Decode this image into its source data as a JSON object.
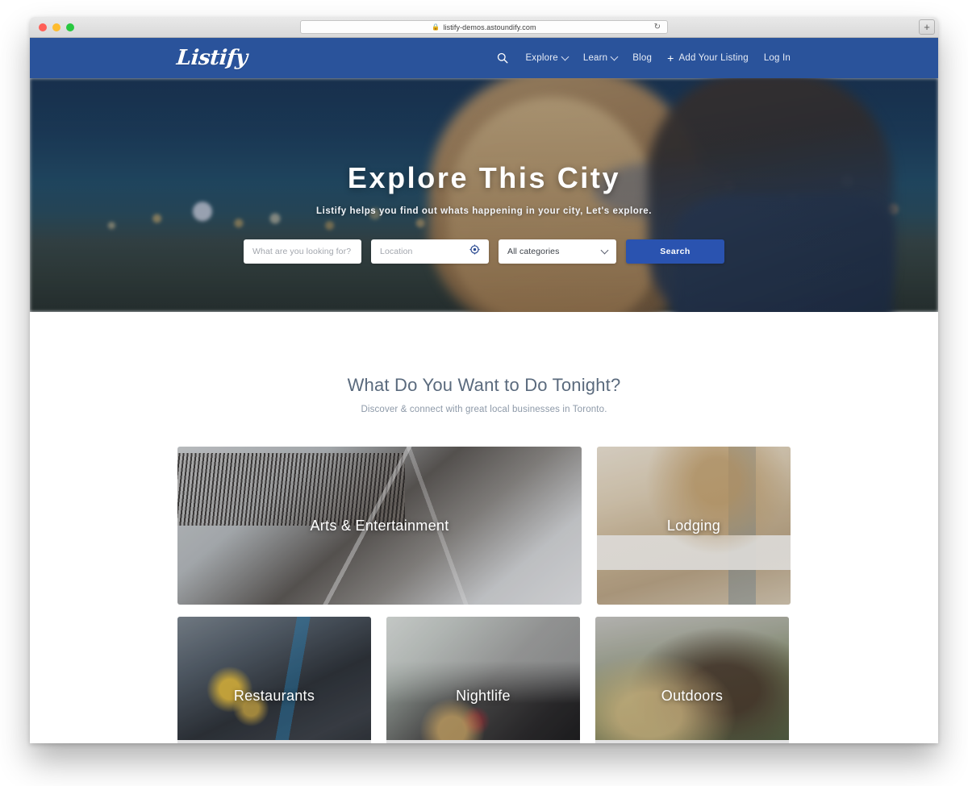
{
  "browser": {
    "url": "listify-demos.astoundify.com",
    "lock_icon": "lock-icon",
    "reload_icon": "reload-icon",
    "newtab_label": "+",
    "traffic_lights": [
      "close-red",
      "minimize-yellow",
      "maximize-green"
    ]
  },
  "navbar": {
    "logo": "Listify",
    "search_icon": "search-icon",
    "items": [
      {
        "label": "Explore",
        "has_caret": true
      },
      {
        "label": "Learn",
        "has_caret": true
      },
      {
        "label": "Blog",
        "has_caret": false
      },
      {
        "label": "Add Your Listing",
        "has_caret": false,
        "plus": "+"
      },
      {
        "label": "Log In",
        "has_caret": false
      }
    ]
  },
  "hero": {
    "title": "Explore This City",
    "subtitle": "Listify helps you find out whats happening in your city, Let's explore.",
    "search": {
      "keyword_placeholder": "What are you looking for?",
      "keyword_value": "",
      "location_placeholder": "Location",
      "location_value": "",
      "locate_icon": "crosshair-locate-icon",
      "category_selected": "All categories",
      "category_chevron": "chevron-down-icon",
      "button_label": "Search"
    }
  },
  "categories": {
    "title": "What Do You Want to Do Tonight?",
    "subtitle": "Discover & connect with great local businesses in Toronto.",
    "rows": [
      [
        {
          "label": "Arts & Entertainment",
          "size": "wide"
        },
        {
          "label": "Lodging",
          "size": "small"
        }
      ],
      [
        {
          "label": "Restaurants",
          "size": "mid"
        },
        {
          "label": "Nightlife",
          "size": "mid"
        },
        {
          "label": "Outdoors",
          "size": "small"
        }
      ]
    ]
  },
  "colors": {
    "navbar_blue": "#2a539b",
    "button_blue": "#2a53b0",
    "heading_slate": "#5a6a7d",
    "subtext_slate": "#8d99a8"
  }
}
